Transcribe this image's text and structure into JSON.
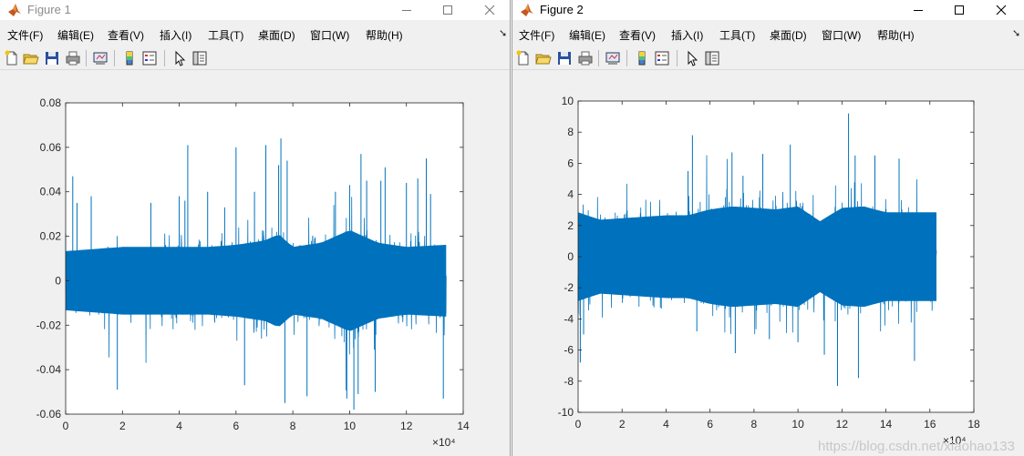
{
  "windows": [
    {
      "title": "Figure 1",
      "active": false,
      "menu": [
        "文件(F)",
        "编辑(E)",
        "查看(V)",
        "插入(I)",
        "工具(T)",
        "桌面(D)",
        "窗口(W)",
        "帮助(H)"
      ],
      "chart_data": {
        "type": "line",
        "series_color": "#0072BD",
        "xlim": [
          0,
          140000
        ],
        "ylim": [
          -0.06,
          0.08
        ],
        "xticks": [
          "0",
          "2",
          "4",
          "6",
          "8",
          "10",
          "12",
          "14"
        ],
        "x_exponent_label": "×10⁴",
        "yticks": [
          "-0.06",
          "-0.04",
          "-0.02",
          "0",
          "0.02",
          "0.04",
          "0.06",
          "0.08"
        ],
        "x_data_range": [
          0,
          134000
        ],
        "envelope": {
          "x": [
            0,
            10000,
            20000,
            30000,
            40000,
            50000,
            60000,
            70000,
            75000,
            80000,
            90000,
            100000,
            110000,
            120000,
            134000
          ],
          "amplitude": [
            0.014,
            0.015,
            0.016,
            0.016,
            0.016,
            0.016,
            0.017,
            0.019,
            0.022,
            0.016,
            0.018,
            0.024,
            0.018,
            0.016,
            0.017
          ]
        },
        "peaks": [
          {
            "x": 2500,
            "y": 0.047
          },
          {
            "x": 4000,
            "y": 0.035
          },
          {
            "x": 9000,
            "y": 0.038
          },
          {
            "x": 18200,
            "y": -0.049
          },
          {
            "x": 30000,
            "y": 0.035
          },
          {
            "x": 40000,
            "y": 0.038
          },
          {
            "x": 42000,
            "y": 0.036
          },
          {
            "x": 43000,
            "y": 0.061
          },
          {
            "x": 50000,
            "y": 0.04
          },
          {
            "x": 56000,
            "y": 0.033
          },
          {
            "x": 60000,
            "y": 0.06
          },
          {
            "x": 63000,
            "y": -0.047
          },
          {
            "x": 66500,
            "y": 0.04
          },
          {
            "x": 70500,
            "y": 0.061
          },
          {
            "x": 75000,
            "y": 0.052
          },
          {
            "x": 75800,
            "y": 0.064
          },
          {
            "x": 77200,
            "y": -0.055
          },
          {
            "x": 78000,
            "y": 0.054
          },
          {
            "x": 85000,
            "y": -0.052
          },
          {
            "x": 95000,
            "y": 0.04
          },
          {
            "x": 99000,
            "y": -0.053
          },
          {
            "x": 100000,
            "y": 0.043
          },
          {
            "x": 101500,
            "y": -0.058
          },
          {
            "x": 103000,
            "y": -0.051
          },
          {
            "x": 104000,
            "y": 0.057
          },
          {
            "x": 106000,
            "y": 0.045
          },
          {
            "x": 109000,
            "y": -0.05
          },
          {
            "x": 111000,
            "y": 0.045
          },
          {
            "x": 112500,
            "y": 0.051
          },
          {
            "x": 120000,
            "y": 0.044
          },
          {
            "x": 124000,
            "y": 0.046
          },
          {
            "x": 127000,
            "y": 0.055
          },
          {
            "x": 128500,
            "y": 0.039
          },
          {
            "x": 133000,
            "y": -0.053
          }
        ]
      }
    },
    {
      "title": "Figure 2",
      "active": true,
      "menu": [
        "文件(F)",
        "编辑(E)",
        "查看(V)",
        "插入(I)",
        "工具(T)",
        "桌面(D)",
        "窗口(W)",
        "帮助(H)"
      ],
      "chart_data": {
        "type": "line",
        "series_color": "#0072BD",
        "xlim": [
          0,
          180000
        ],
        "ylim": [
          -10,
          10
        ],
        "xticks": [
          "0",
          "2",
          "4",
          "6",
          "8",
          "10",
          "12",
          "14",
          "16",
          "18"
        ],
        "x_exponent_label": "×10⁴",
        "yticks": [
          "-10",
          "-8",
          "-6",
          "-4",
          "-2",
          "0",
          "2",
          "4",
          "6",
          "8",
          "10"
        ],
        "x_data_range": [
          0,
          163000
        ],
        "envelope": {
          "x": [
            0,
            10000,
            20000,
            30000,
            40000,
            50000,
            60000,
            70000,
            80000,
            90000,
            100000,
            110000,
            120000,
            130000,
            140000,
            150000,
            163000
          ],
          "amplitude": [
            3.0,
            2.5,
            2.6,
            2.7,
            2.8,
            2.8,
            3.2,
            3.4,
            3.3,
            3.2,
            3.4,
            2.4,
            3.3,
            3.4,
            3.0,
            3.0,
            3.0
          ]
        },
        "peaks": [
          {
            "x": 1000,
            "y": -6.8
          },
          {
            "x": 2500,
            "y": -5.0
          },
          {
            "x": 50000,
            "y": 5.5
          },
          {
            "x": 52000,
            "y": 7.8
          },
          {
            "x": 54000,
            "y": -4.8
          },
          {
            "x": 70000,
            "y": 6.7
          },
          {
            "x": 71500,
            "y": -6.2
          },
          {
            "x": 75000,
            "y": 5.2
          },
          {
            "x": 84000,
            "y": 6.6
          },
          {
            "x": 87000,
            "y": -5.3
          },
          {
            "x": 96500,
            "y": 7.2
          },
          {
            "x": 100000,
            "y": -5.5
          },
          {
            "x": 112000,
            "y": -6.3
          },
          {
            "x": 118000,
            "y": -8.3
          },
          {
            "x": 123000,
            "y": 9.2
          },
          {
            "x": 126000,
            "y": 6.5
          },
          {
            "x": 127500,
            "y": -7.8
          },
          {
            "x": 135000,
            "y": 6.5
          },
          {
            "x": 146000,
            "y": 6.3
          },
          {
            "x": 153000,
            "y": -6.7
          }
        ]
      }
    }
  ],
  "watermark": "https://blog.csdn.net/xiaohao133"
}
